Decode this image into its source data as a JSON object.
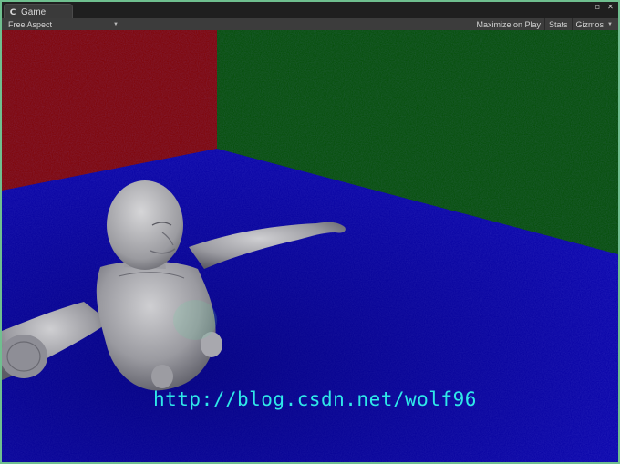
{
  "tab": {
    "title": "Game",
    "icon": "game-controller-icon"
  },
  "window_controls": {
    "maximize_icon": "maximize-icon",
    "close_icon": "close-icon",
    "menu_icon": "tab-menu-icon"
  },
  "toolbar": {
    "aspect_label": "Free Aspect",
    "maximize_on_play_label": "Maximize on Play",
    "stats_label": "Stats",
    "gizmos_label": "Gizmos"
  },
  "scene": {
    "watermark": "http://blog.csdn.net/wolf96",
    "colors": {
      "left_wall": "#7e0000",
      "back_wall": "#004d00",
      "floor": "#0600ac",
      "accent": "#2fe8e8"
    }
  }
}
